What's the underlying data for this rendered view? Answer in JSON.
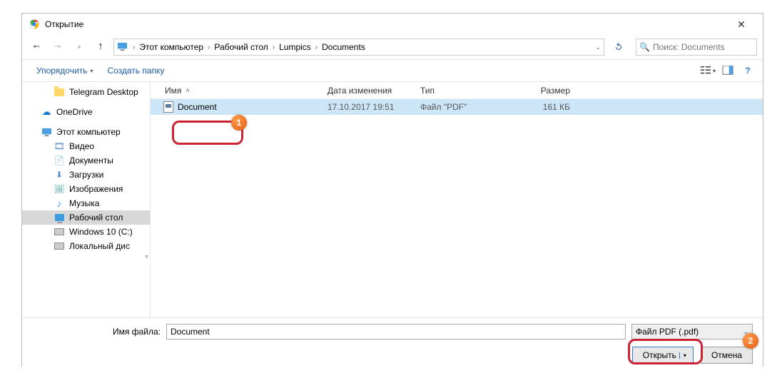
{
  "window": {
    "title": "Открытие"
  },
  "nav": {
    "breadcrumb": [
      "Этот компьютер",
      "Рабочий стол",
      "Lumpics",
      "Documents"
    ],
    "search_placeholder": "Поиск: Documents"
  },
  "toolbar": {
    "organize": "Упорядочить",
    "new_folder": "Создать папку"
  },
  "sidebar": {
    "items": [
      {
        "label": "Telegram Desktop",
        "icon": "folder",
        "depth": 2
      },
      {
        "label": "OneDrive",
        "icon": "cloud",
        "depth": 1
      },
      {
        "label": "Этот компьютер",
        "icon": "pc",
        "depth": 1
      },
      {
        "label": "Видео",
        "icon": "doc",
        "depth": 2
      },
      {
        "label": "Документы",
        "icon": "doc",
        "depth": 2
      },
      {
        "label": "Загрузки",
        "icon": "dl",
        "depth": 2
      },
      {
        "label": "Изображения",
        "icon": "pic",
        "depth": 2
      },
      {
        "label": "Музыка",
        "icon": "music",
        "depth": 2
      },
      {
        "label": "Рабочий стол",
        "icon": "mon",
        "depth": 2,
        "selected": true
      },
      {
        "label": "Windows 10 (C:)",
        "icon": "drive",
        "depth": 2
      },
      {
        "label": "Локальный дис",
        "icon": "drive",
        "depth": 2
      }
    ]
  },
  "columns": {
    "name": "Имя",
    "date": "Дата изменения",
    "type": "Тип",
    "size": "Размер"
  },
  "files": [
    {
      "name": "Document",
      "date": "17.10.2017 19:51",
      "type": "Файл \"PDF\"",
      "size": "161 КБ",
      "selected": true
    }
  ],
  "footer": {
    "filename_label": "Имя файла:",
    "filename_value": "Document",
    "filter": "Файл PDF (.pdf)",
    "open": "Открыть",
    "cancel": "Отмена"
  },
  "badges": {
    "one": "1",
    "two": "2"
  }
}
